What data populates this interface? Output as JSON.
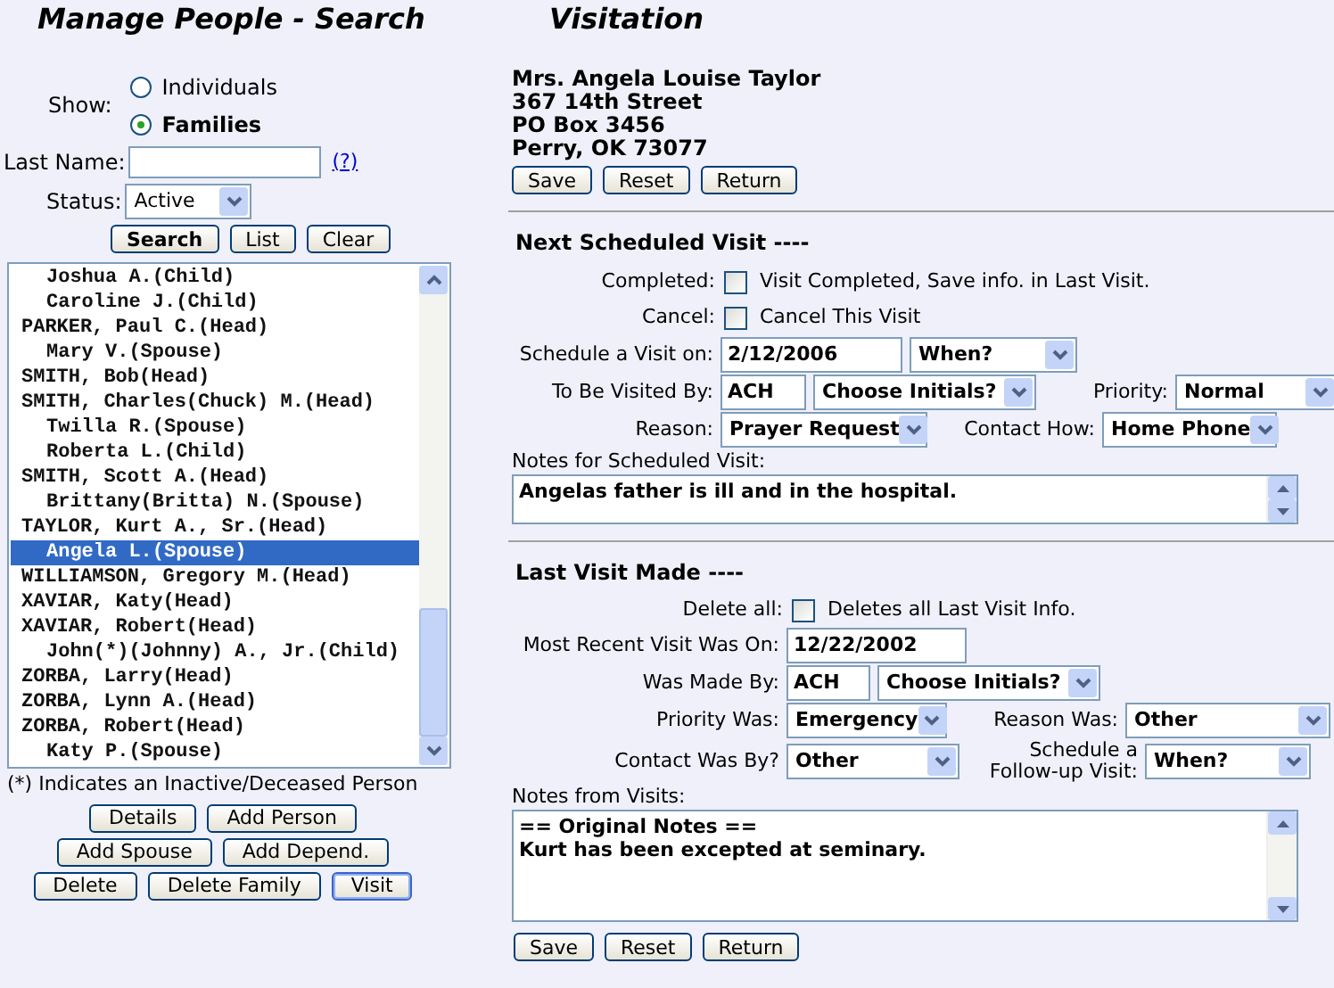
{
  "search": {
    "title": "Manage People - Search",
    "show_label": "Show:",
    "show_options": [
      {
        "label": "Individuals",
        "selected": false
      },
      {
        "label": "Families",
        "selected": true
      }
    ],
    "last_name_label": "Last Name:",
    "help_link": "(?)",
    "status_label": "Status:",
    "status_value": "Active",
    "buttons": [
      {
        "label": "Search",
        "kind": "default"
      },
      {
        "label": "List",
        "kind": "normal"
      },
      {
        "label": "Clear",
        "kind": "normal"
      }
    ],
    "people": [
      {
        "text": "Joshua A.(Child)",
        "kind": "member",
        "selected": false
      },
      {
        "text": "Caroline J.(Child)",
        "kind": "member",
        "selected": false
      },
      {
        "text": "PARKER, Paul C.(Head)",
        "kind": "head",
        "selected": false
      },
      {
        "text": "Mary V.(Spouse)",
        "kind": "member",
        "selected": false
      },
      {
        "text": "SMITH, Bob(Head)",
        "kind": "head",
        "selected": false
      },
      {
        "text": "SMITH, Charles(Chuck) M.(Head)",
        "kind": "head",
        "selected": false
      },
      {
        "text": "Twilla R.(Spouse)",
        "kind": "member",
        "selected": false
      },
      {
        "text": "Roberta L.(Child)",
        "kind": "member",
        "selected": false
      },
      {
        "text": "SMITH, Scott A.(Head)",
        "kind": "head",
        "selected": false
      },
      {
        "text": "Brittany(Britta) N.(Spouse)",
        "kind": "member",
        "selected": false
      },
      {
        "text": "TAYLOR, Kurt A., Sr.(Head)",
        "kind": "head",
        "selected": false
      },
      {
        "text": "Angela L.(Spouse)",
        "kind": "member",
        "selected": true
      },
      {
        "text": "WILLIAMSON, Gregory M.(Head)",
        "kind": "head",
        "selected": false
      },
      {
        "text": "XAVIAR, Katy(Head)",
        "kind": "head",
        "selected": false
      },
      {
        "text": "XAVIAR, Robert(Head)",
        "kind": "head",
        "selected": false
      },
      {
        "text": "John(*)(Johnny) A., Jr.(Child)",
        "kind": "member",
        "selected": false
      },
      {
        "text": "ZORBA, Larry(Head)",
        "kind": "head",
        "selected": false
      },
      {
        "text": "ZORBA, Lynn A.(Head)",
        "kind": "head",
        "selected": false
      },
      {
        "text": "ZORBA, Robert(Head)",
        "kind": "head",
        "selected": false
      },
      {
        "text": "Katy P.(Spouse)",
        "kind": "member",
        "selected": false
      }
    ],
    "legend": "(*) Indicates an Inactive/Deceased Person",
    "action_rows": [
      [
        {
          "label": "Details",
          "kind": "normal"
        },
        {
          "label": "Add Person",
          "kind": "normal"
        }
      ],
      [
        {
          "label": "Add Spouse",
          "kind": "normal"
        },
        {
          "label": "Add Depend.",
          "kind": "normal"
        }
      ],
      [
        {
          "label": "Delete",
          "kind": "normal"
        },
        {
          "label": "Delete Family",
          "kind": "normal"
        },
        {
          "label": "Visit",
          "kind": "focused"
        }
      ]
    ]
  },
  "visitation": {
    "title": "Visitation",
    "address": [
      "Mrs. Angela Louise Taylor",
      "367 14th Street",
      "PO Box 3456",
      "Perry, OK 73077"
    ],
    "top_buttons": [
      "Save",
      "Reset",
      "Return"
    ],
    "next_visit": {
      "heading": "Next Scheduled Visit ----",
      "completed": {
        "label": "Completed:",
        "checked": false,
        "text": "Visit Completed, Save info. in Last Visit."
      },
      "cancel": {
        "label": "Cancel:",
        "checked": false,
        "text": "Cancel This Visit"
      },
      "schedule": {
        "label": "Schedule a Visit on:",
        "date": "2/12/2006",
        "when": "When?"
      },
      "visited_by": {
        "label": "To Be Visited By:",
        "initials": "ACH",
        "choose": "Choose Initials?"
      },
      "priority": {
        "label": "Priority:",
        "value": "Normal"
      },
      "reason": {
        "label": "Reason:",
        "value": "Prayer Request"
      },
      "contact": {
        "label": "Contact How:",
        "value": "Home Phone"
      },
      "notes_label": "Notes for Scheduled Visit:",
      "notes": "Angelas father is ill and in the hospital."
    },
    "last_visit": {
      "heading": "Last Visit Made ----",
      "delete_all": {
        "label": "Delete all:",
        "checked": false,
        "text": "Deletes all Last Visit Info."
      },
      "recent": {
        "label": "Most Recent Visit Was On:",
        "value": "12/22/2002"
      },
      "made_by": {
        "label": "Was Made By:",
        "initials": "ACH",
        "choose": "Choose Initials?"
      },
      "priority_was": {
        "label": "Priority Was:",
        "value": "Emergency"
      },
      "reason_was": {
        "label": "Reason Was:",
        "value": "Other"
      },
      "contact_was": {
        "label": "Contact Was By?",
        "value": "Other"
      },
      "follow_up": {
        "label": "Schedule a Follow-up Visit:",
        "value": "When?"
      },
      "notes_label": "Notes from Visits:",
      "notes": "== Original Notes ==\nKurt has been excepted at seminary."
    },
    "bottom_buttons": [
      "Save",
      "Reset",
      "Return"
    ]
  }
}
